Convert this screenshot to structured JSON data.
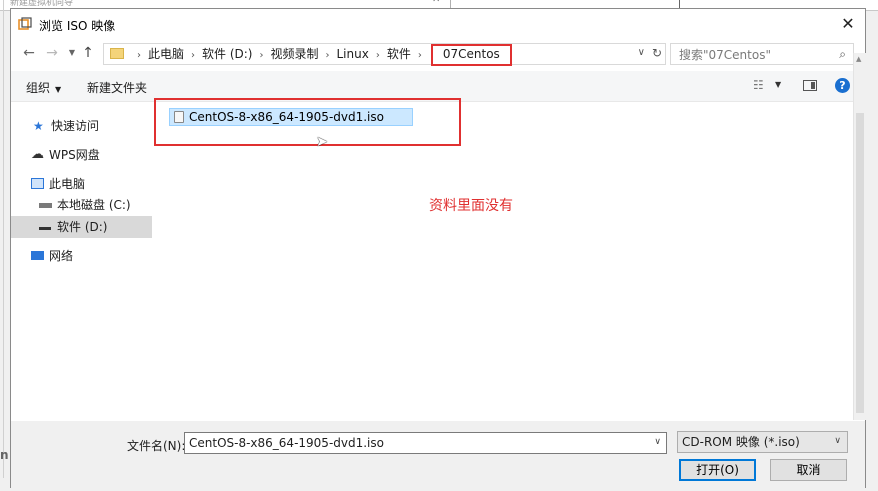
{
  "background": {
    "window_text": "新建虚拟机向导",
    "close_glyph": "✕",
    "left_letter": "n"
  },
  "dialog": {
    "title": "浏览 ISO 映像",
    "close_glyph": "✕"
  },
  "address": {
    "crumbs": [
      "此电脑",
      "软件 (D:)",
      "视频录制",
      "Linux",
      "软件"
    ],
    "current": "07Centos",
    "search_placeholder": "搜索\"07Centos\""
  },
  "toolbar": {
    "organize": "组织",
    "new_folder": "新建文件夹"
  },
  "nav": {
    "quick_access": "快速访问",
    "wps_drive": "WPS网盘",
    "this_pc": "此电脑",
    "local_disk_c": "本地磁盘 (C:)",
    "software_d": "软件 (D:)",
    "network": "网络"
  },
  "files": [
    {
      "name": "CentOS-8-x86_64-1905-dvd1.iso",
      "selected": true
    }
  ],
  "annotation": {
    "note": "资料里面没有",
    "color": "#e03030"
  },
  "bottom": {
    "filename_label": "文件名(N):",
    "filename_value": "CentOS-8-x86_64-1905-dvd1.iso",
    "filetype": "CD-ROM 映像 (*.iso)",
    "open": "打开(O)",
    "cancel": "取消"
  },
  "colors": {
    "selection": "#cce8ff",
    "accent": "#0078d7"
  }
}
